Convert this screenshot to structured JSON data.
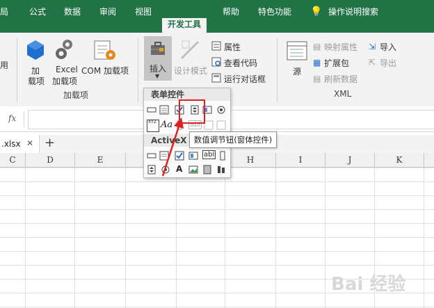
{
  "ribbon_tabs": [
    "局",
    "公式",
    "数据",
    "审阅",
    "视图",
    "开发工具",
    "帮助",
    "特色功能",
    "操作说明搜索"
  ],
  "active_tab": "开发工具",
  "ribbon": {
    "left_partial": "用",
    "addins": {
      "addin_label_1": "加",
      "addin_label_2": "载项",
      "excel_label_1": "Excel",
      "excel_label_2": "加载项",
      "com_label": "COM 加载项",
      "group_label": "加载项"
    },
    "controls": {
      "insert_label": "插入",
      "design_mode_label": "设计模式",
      "properties_label": "属性",
      "view_code_label": "查看代码",
      "run_dialog_label": "运行对话框"
    },
    "xml": {
      "source_label": "源",
      "map_props_label": "映射属性",
      "expansion_label": "扩展包",
      "refresh_label": "刷新数据",
      "import_label": "导入",
      "export_label": "导出",
      "group_label": "XML"
    }
  },
  "formula_bar": {
    "fx_label": "fx",
    "cancel_label": "✕"
  },
  "sheet_tab": {
    "file_name": ".xlsx",
    "close": "✕",
    "add": "+"
  },
  "columns": [
    "C",
    "D",
    "E",
    "",
    "",
    "H",
    "I",
    "J",
    "K"
  ],
  "dropdown": {
    "form_controls_header": "表单控件",
    "activex_header": "ActiveX 控件",
    "label_aa": "Aa",
    "label_xyz": "XYZ",
    "label_abl": "abl",
    "label_a": "A"
  },
  "tooltip": "数值调节钮(窗体控件)",
  "watermark": "Bai 经验",
  "colors": {
    "excel_green": "#217346",
    "highlight_red": "#e02020"
  }
}
